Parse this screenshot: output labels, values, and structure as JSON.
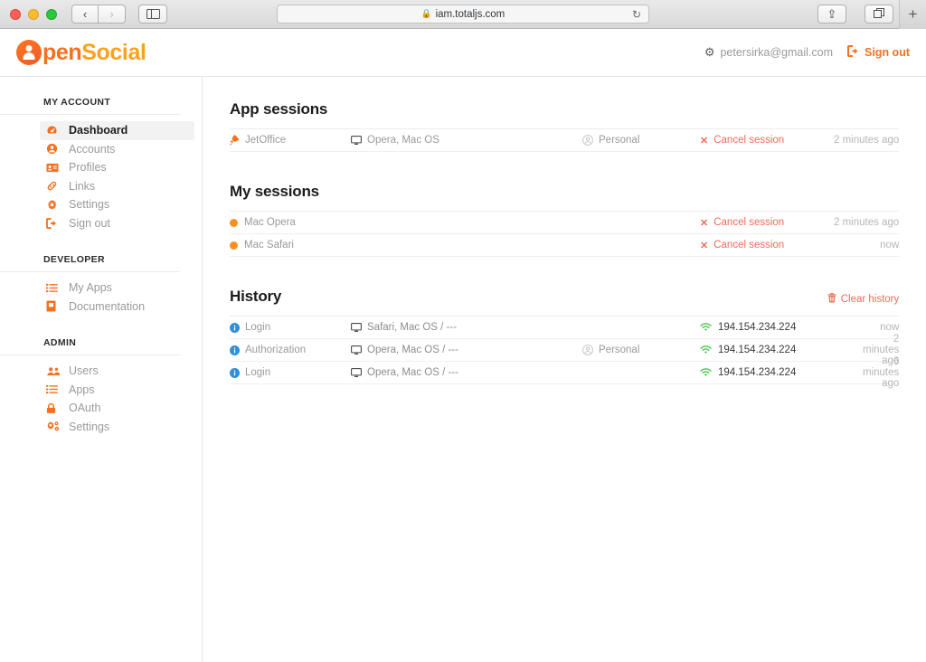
{
  "browser": {
    "url": "iam.totaljs.com",
    "lock_icon": "lock-icon",
    "reload_icon": "reload-icon",
    "back_icon": "chevron-left-icon",
    "forward_icon": "chevron-right-icon",
    "sidebar_icon": "sidebar-toggle-icon",
    "share_icon": "share-icon",
    "tabs_icon": "show-tabs-icon",
    "new_tab_label": "+"
  },
  "header": {
    "logo_first": "pen",
    "logo_second": "Social",
    "user_email": "petersirka@gmail.com",
    "signout_label": "Sign out"
  },
  "sidebar": {
    "sections": [
      {
        "title": "MY ACCOUNT",
        "items": [
          {
            "label": "Dashboard",
            "icon": "dashboard-icon",
            "active": true
          },
          {
            "label": "Accounts",
            "icon": "user-circle-icon",
            "active": false
          },
          {
            "label": "Profiles",
            "icon": "id-card-icon",
            "active": false
          },
          {
            "label": "Links",
            "icon": "link-icon",
            "active": false
          },
          {
            "label": "Settings",
            "icon": "gear-icon",
            "active": false
          },
          {
            "label": "Sign out",
            "icon": "sign-out-icon",
            "active": false
          }
        ]
      },
      {
        "title": "DEVELOPER",
        "items": [
          {
            "label": "My Apps",
            "icon": "list-icon",
            "active": false
          },
          {
            "label": "Documentation",
            "icon": "book-icon",
            "active": false
          }
        ]
      },
      {
        "title": "ADMIN",
        "items": [
          {
            "label": "Users",
            "icon": "users-icon",
            "active": false
          },
          {
            "label": "Apps",
            "icon": "list-icon",
            "active": false
          },
          {
            "label": "OAuth",
            "icon": "lock-icon",
            "active": false
          },
          {
            "label": "Settings",
            "icon": "cogs-icon",
            "active": false
          }
        ]
      }
    ]
  },
  "main": {
    "app_sessions": {
      "title": "App sessions",
      "rows": [
        {
          "app": "JetOffice",
          "device": "Opera, Mac OS",
          "scope": "Personal",
          "cancel": "Cancel session",
          "time": "2 minutes ago"
        }
      ]
    },
    "my_sessions": {
      "title": "My sessions",
      "rows": [
        {
          "name": "Mac Opera",
          "cancel": "Cancel session",
          "time": "2 minutes ago"
        },
        {
          "name": "Mac Safari",
          "cancel": "Cancel session",
          "time": "now"
        }
      ]
    },
    "history": {
      "title": "History",
      "clear_label": "Clear history",
      "rows": [
        {
          "type": "Login",
          "device": "Safari, Mac OS / ---",
          "scope": "",
          "ip": "194.154.234.224",
          "time": "now"
        },
        {
          "type": "Authorization",
          "device": "Opera, Mac OS / ---",
          "scope": "Personal",
          "ip": "194.154.234.224",
          "time": "2 minutes ago"
        },
        {
          "type": "Login",
          "device": "Opera, Mac OS / ---",
          "scope": "",
          "ip": "194.154.234.224",
          "time": "6 minutes ago"
        }
      ]
    }
  },
  "colors": {
    "brand_orange": "#f4711f",
    "brand_light_orange": "#fca21c",
    "danger": "#ef6b5b",
    "info": "#2f8fd8",
    "success": "#4ec54e"
  }
}
